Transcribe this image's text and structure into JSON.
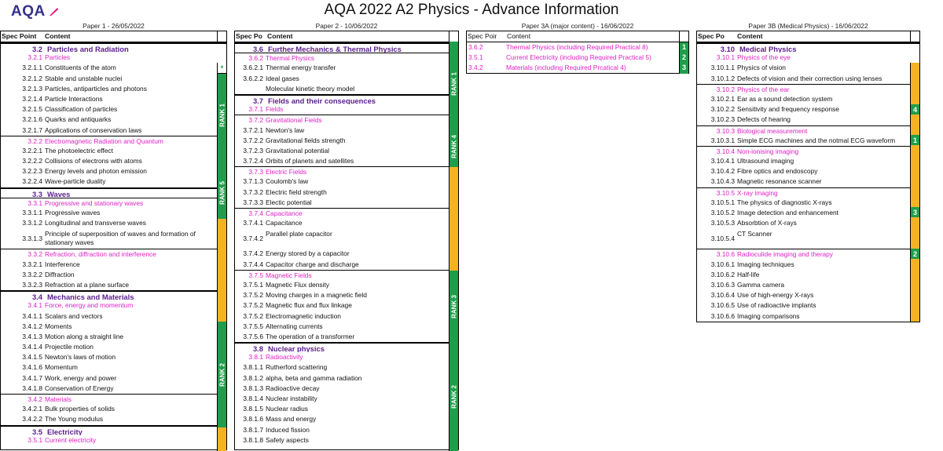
{
  "logo": {
    "text": "AQA"
  },
  "title": "AQA 2022 A2 Physics - Advance Information",
  "headers": {
    "spec": "Spec Point",
    "content": "Content"
  },
  "p1": {
    "label": "Paper 1 - 26/05/2022",
    "hdr_spec": "Spec Point",
    "rows": [
      {
        "n": "3.2",
        "t": "Particles and Radiation"
      },
      {
        "n": "3.2.1",
        "t": "Particles"
      },
      {
        "n": "3.2.1.1",
        "t": "Constituents of the atom"
      },
      {
        "n": "3.2.1.2",
        "t": "Stable and unstable nuclei"
      },
      {
        "n": "3.2.1.3",
        "t": "Particles, antiparticles and photons"
      },
      {
        "n": "3.2.1.4",
        "t": "Particle Interactions"
      },
      {
        "n": "3.2.1.5",
        "t": "Classification of particles"
      },
      {
        "n": "3.2.1.6",
        "t": "Quarks and antiquarks"
      },
      {
        "n": "3.2.1.7",
        "t": "Applications of conservation laws"
      },
      {
        "n": "3.2.2",
        "t": "Electromagnetic Radiation and Quantum"
      },
      {
        "n": "3.2.2.1",
        "t": "The photoelectric effect"
      },
      {
        "n": "3.2.2.2",
        "t": "Collisions of electrons with atoms"
      },
      {
        "n": "3.2.2.3",
        "t": "Energy levels and photon emission"
      },
      {
        "n": "3.2.2.4",
        "t": "Wave-particle duality"
      },
      {
        "n": "3.3",
        "t": "Waves"
      },
      {
        "n": "3.3.1",
        "t": "Progressive and stationary waves"
      },
      {
        "n": "3.3.1.1",
        "t": "Progressive waves"
      },
      {
        "n": "3.3.1.2",
        "t": "Longitudinal and transverse waves"
      },
      {
        "n": "3.3.1.3",
        "t": "Principle of superposition of waves and formation of stationary waves"
      },
      {
        "n": "3.3.2",
        "t": "Refraction, diffraction and interference"
      },
      {
        "n": "3.3.2.1",
        "t": "Interference"
      },
      {
        "n": "3.3.2.2",
        "t": "Diffraction"
      },
      {
        "n": "3.3.2.3",
        "t": "Refraction at a plane surface"
      },
      {
        "n": "3.4",
        "t": "Mechanics and Materials"
      },
      {
        "n": "3.4.1",
        "t": "Force, energy and momentum"
      },
      {
        "n": "3.4.1.1",
        "t": "Scalars and vectors"
      },
      {
        "n": "3.4.1.2",
        "t": "Moments"
      },
      {
        "n": "3.4.1.3",
        "t": "Motion along a straight line"
      },
      {
        "n": "3.4.1.4",
        "t": "Projectile motion"
      },
      {
        "n": "3.4.1.5",
        "t": "Newton's laws of motion"
      },
      {
        "n": "3.4.1.6",
        "t": "Momentum"
      },
      {
        "n": "3.4.1.7",
        "t": "Work, energy and power"
      },
      {
        "n": "3.4.1.8",
        "t": "Conservation of Energy"
      },
      {
        "n": "3.4.2",
        "t": "Materials"
      },
      {
        "n": "3.4.2.1",
        "t": "Bulk properties of solids"
      },
      {
        "n": "3.4.2.2",
        "t": "The Young modulus"
      },
      {
        "n": "3.5",
        "t": "Electricity"
      },
      {
        "n": "3.5.1",
        "t": "Current electricity"
      }
    ],
    "ranks": {
      "r1": "RANK 1",
      "r5": "RANK 5",
      "r2": "RANK 2",
      "dot": "*"
    }
  },
  "p2": {
    "label": "Paper 2 - 10/06/2022",
    "hdr_spec": "Spec Po",
    "rows": [
      {
        "n": "3.6",
        "t": "Further Mechanics & Thermal Physics"
      },
      {
        "n": "3.6.2",
        "t": "Thermal Physics"
      },
      {
        "n": "3.6.2.1",
        "t": "Thermal energy transfer"
      },
      {
        "n": "3.6.2.2",
        "t": "Ideal gases"
      },
      {
        "n": "",
        "t": "Molecular kinetic theory model"
      },
      {
        "n": "3.7",
        "t": "Fields and their consequences"
      },
      {
        "n": "3.7.1",
        "t": "Fields"
      },
      {
        "n": "3.7.2",
        "t": "Gravitational Fields"
      },
      {
        "n": "3.7.2.1",
        "t": "Newton's law"
      },
      {
        "n": "3.7.2.2",
        "t": "Gravitational fields strength"
      },
      {
        "n": "3.7.2.3",
        "t": "Gravitational potential"
      },
      {
        "n": "3.7.2.4",
        "t": "Orbits of planets and satellites"
      },
      {
        "n": "3.7.3",
        "t": "Electric Fields"
      },
      {
        "n": "3.7.1.3",
        "t": "Coulomb's law"
      },
      {
        "n": "3.7.3.2",
        "t": "Electric field strength"
      },
      {
        "n": "3.7.3.3",
        "t": "Electic potential"
      },
      {
        "n": "3.7.4",
        "t": "Capacitance"
      },
      {
        "n": "3.7.4.1",
        "t": "Capacitance"
      },
      {
        "n": "3.7.4.2",
        "t": "Parallel plate capacitor"
      },
      {
        "n": "3.7.4.2",
        "t": "Energy stored by a capacitor"
      },
      {
        "n": "3.7.4.4",
        "t": "Capacitor charge and discharge"
      },
      {
        "n": "3.7.5",
        "t": "Magnetic Fields"
      },
      {
        "n": "3.7.5.1",
        "t": "Magnetic Flux density"
      },
      {
        "n": "3.7.5.2",
        "t": "Moving charges in a magnetic field"
      },
      {
        "n": "3.7.5.2",
        "t": "Magnetic flux and flux linkage"
      },
      {
        "n": "3.7.5.2",
        "t": "Electromagnetic induction"
      },
      {
        "n": "3.7.5.5",
        "t": "Alternating currents"
      },
      {
        "n": "3.7.5.6",
        "t": "The operation of a transformer"
      },
      {
        "n": "3.8",
        "t": "Nuclear physics"
      },
      {
        "n": "3.8.1",
        "t": "Radioactivity"
      },
      {
        "n": "3.8.1.1",
        "t": "Rutherford scattering"
      },
      {
        "n": "3.8.1.2",
        "t": "alpha, beta and gamma radiation"
      },
      {
        "n": "3.8.1.3",
        "t": "Radioactive decay"
      },
      {
        "n": "3.8.1.4",
        "t": "Nuclear instability"
      },
      {
        "n": "3.8.1.5",
        "t": "Nuclear radius"
      },
      {
        "n": "3.8.1.6",
        "t": "Mass and energy"
      },
      {
        "n": "3.8.1.7",
        "t": "Induced fission"
      },
      {
        "n": "3.8.1.8",
        "t": "Safety aspects"
      }
    ],
    "ranks": {
      "r1": "RANK 1",
      "r4": "RANK 4",
      "r3": "RANK 3",
      "r2": "RANK 2"
    }
  },
  "p3a": {
    "label": "Paper 3A (major content) - 16/06/2022",
    "hdr_spec": "Spec Poir",
    "rows": [
      {
        "n": "3.6.2",
        "t": "Thermal Physics (including Required Practical 8)",
        "r": "1"
      },
      {
        "n": "3.5.1",
        "t": "Current Electricity (including Required Practical 5)",
        "r": "2"
      },
      {
        "n": "3.4.2",
        "t": "Materials (including Required Prcatical 4)",
        "r": "3"
      }
    ]
  },
  "p3b": {
    "label": "Paper 3B (Medical Physics) - 16/06/2022",
    "hdr_spec": "Spec Po",
    "rows": [
      {
        "n": "3.10",
        "t": "Medical Physics"
      },
      {
        "n": "3.10.1",
        "t": "Physics of the eye"
      },
      {
        "n": "3.10.1.1",
        "t": "Physics of vision"
      },
      {
        "n": "3.10.1.2",
        "t": "Defects of vision and their correction using lenses"
      },
      {
        "n": "3.10.2",
        "t": "Physics of the ear"
      },
      {
        "n": "3.10.2.1",
        "t": "Ear as a sound detection system"
      },
      {
        "n": "3.10.2.2",
        "t": "Sensitivity and frequency response"
      },
      {
        "n": "3.10.2.3",
        "t": "Defects of hearing"
      },
      {
        "n": "3.10.3",
        "t": "Biological measurement"
      },
      {
        "n": "3.10.3.1",
        "t": "Simple ECG machines and the notmal ECG waveform"
      },
      {
        "n": "3.10.4",
        "t": "Non-ionising imaging"
      },
      {
        "n": "3.10.4.1",
        "t": "Ultrasound imaging"
      },
      {
        "n": "3.10.4.2",
        "t": "Fibre optics and endoscopy"
      },
      {
        "n": "3.10.4.3",
        "t": "Magnetic resonance scanner"
      },
      {
        "n": "3.10.5",
        "t": "X-ray imaging"
      },
      {
        "n": "3.10.5.1",
        "t": "The physics of diagnostic X-rays"
      },
      {
        "n": "3.10.5.2",
        "t": "Image detection and enhancement"
      },
      {
        "n": "3.10.5.3",
        "t": "Absorbtion of X-rays"
      },
      {
        "n": "3.10.5.4",
        "t": "CT Scanner"
      },
      {
        "n": "3.10.6",
        "t": "Radioculide imaging and therapy"
      },
      {
        "n": "3.10.6.1",
        "t": "Imaging techniques"
      },
      {
        "n": "3.10.6.2",
        "t": "Half-life"
      },
      {
        "n": "3.10.6.3",
        "t": "Gamma camera"
      },
      {
        "n": "3.10.6.4",
        "t": "Use of high-energy X-rays"
      },
      {
        "n": "3.10.6.5",
        "t": "Use of radioactive implants"
      },
      {
        "n": "3.10.6.6",
        "t": "Imaging comparisons"
      }
    ],
    "ranks": {
      "r4": "4",
      "r1": "1",
      "r3": "3",
      "r2": "2"
    }
  },
  "colors": {
    "rank_green": "#1e9e4a",
    "rank_orange": "#f5b320",
    "section_purple": "#5a1e8c",
    "subsection_magenta": "#e020c6",
    "logo_blue": "#34318a",
    "logo_pink": "#e6007e"
  }
}
